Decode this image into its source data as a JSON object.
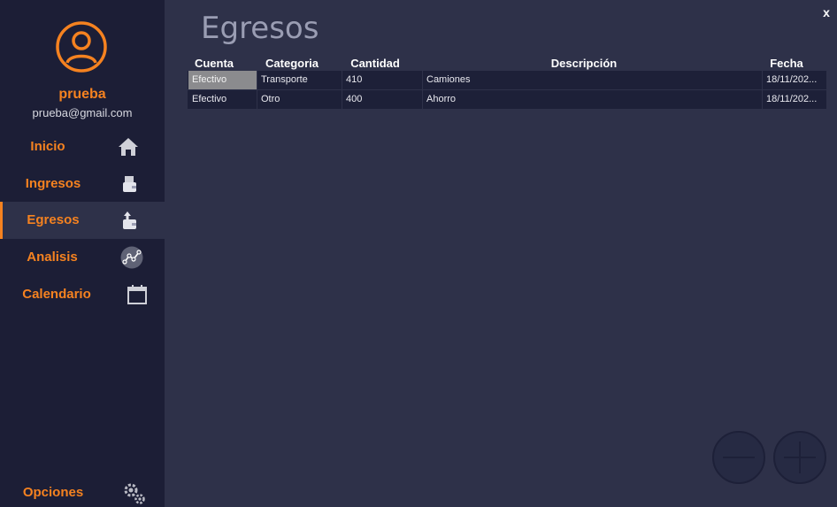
{
  "window": {
    "close_label": "x",
    "title": "Egresos"
  },
  "user": {
    "name": "prueba",
    "email": "prueba@gmail.com"
  },
  "nav": {
    "items": [
      {
        "label": "Inicio",
        "icon": "home-icon"
      },
      {
        "label": "Ingresos",
        "icon": "wallet-in-icon"
      },
      {
        "label": "Egresos",
        "icon": "wallet-out-icon",
        "active": true
      },
      {
        "label": "Analisis",
        "icon": "analytics-icon"
      },
      {
        "label": "Calendario",
        "icon": "calendar-icon"
      }
    ],
    "options": {
      "label": "Opciones",
      "icon": "gears-icon"
    }
  },
  "table": {
    "columns": [
      "Cuenta",
      "Categoria",
      "Cantidad",
      "Descripción",
      "Fecha"
    ],
    "rows": [
      {
        "cuenta": "Efectivo",
        "categoria": "Transporte",
        "cantidad": "410",
        "descripcion": "Camiones",
        "fecha": "18/11/202..."
      },
      {
        "cuenta": "Efectivo",
        "categoria": "Otro",
        "cantidad": "400",
        "descripcion": "Ahorro",
        "fecha": "18/11/202..."
      }
    ]
  },
  "actions": {
    "remove_icon": "minus-icon",
    "add_icon": "plus-icon"
  },
  "colors": {
    "accent": "#f58220",
    "sidebar": "#1c1e36",
    "background": "#2e3149",
    "row": "#1d2038"
  }
}
